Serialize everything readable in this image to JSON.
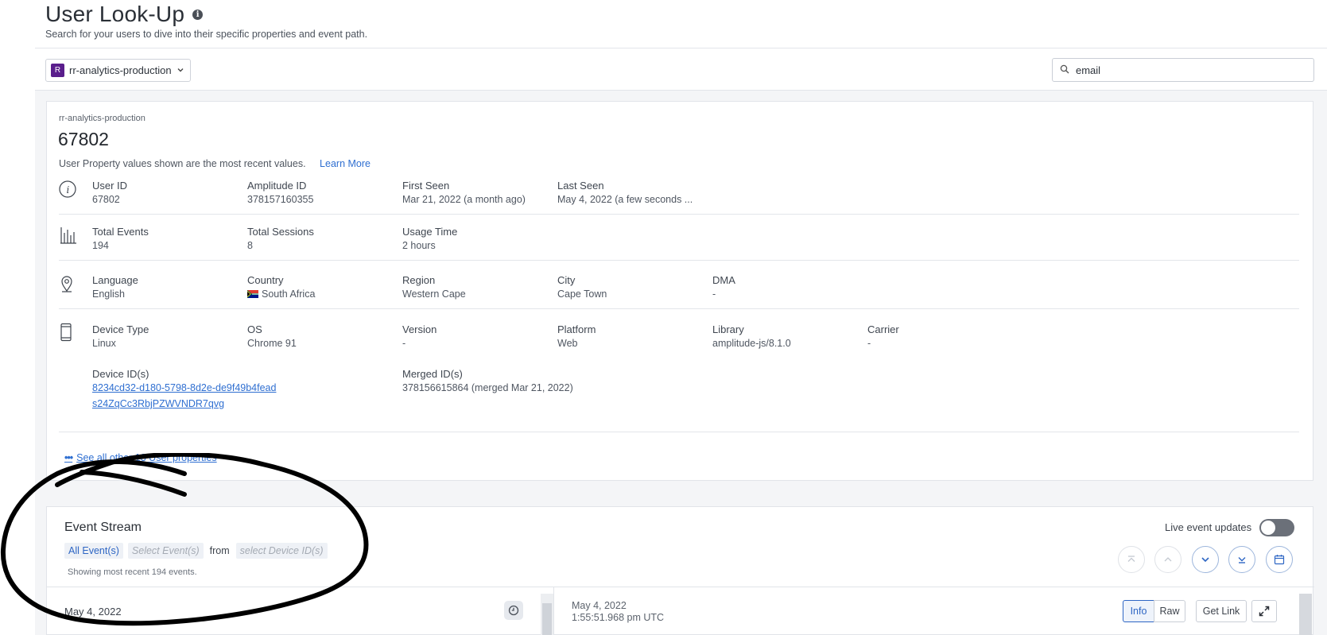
{
  "page": {
    "title": "User Look-Up",
    "subtitle": "Search for your users to dive into their specific properties and event path."
  },
  "toolbar": {
    "project_badge": "R",
    "project_name": "rr-analytics-production",
    "search_value": "email"
  },
  "profile": {
    "project_label": "rr-analytics-production",
    "user_display": "67802",
    "note": "User Property values shown are the most recent values.",
    "learn_more": "Learn More",
    "identity": {
      "user_id_label": "User ID",
      "user_id": "67802",
      "amplitude_id_label": "Amplitude ID",
      "amplitude_id": "378157160355",
      "first_seen_label": "First Seen",
      "first_seen": "Mar 21, 2022 (a month ago)",
      "last_seen_label": "Last Seen",
      "last_seen": "May 4, 2022 (a few seconds ..."
    },
    "usage": {
      "total_events_label": "Total Events",
      "total_events": "194",
      "total_sessions_label": "Total Sessions",
      "total_sessions": "8",
      "usage_time_label": "Usage Time",
      "usage_time": "2 hours"
    },
    "location": {
      "language_label": "Language",
      "language": "English",
      "country_label": "Country",
      "country": "South Africa",
      "region_label": "Region",
      "region": "Western Cape",
      "city_label": "City",
      "city": "Cape Town",
      "dma_label": "DMA",
      "dma": "-"
    },
    "device": {
      "device_type_label": "Device Type",
      "device_type": "Linux",
      "os_label": "OS",
      "os": "Chrome 91",
      "version_label": "Version",
      "version": "-",
      "platform_label": "Platform",
      "platform": "Web",
      "library_label": "Library",
      "library": "amplitude-js/8.1.0",
      "carrier_label": "Carrier",
      "carrier": "-",
      "device_ids_label": "Device ID(s)",
      "device_ids": [
        "8234cd32-d180-5798-8d2e-de9f49b4fead",
        "s24ZqCc3RbjPZWVNDR7qvg"
      ],
      "merged_ids_label": "Merged ID(s)",
      "merged_ids": "378156615864 (merged Mar 21, 2022)"
    },
    "see_all": "See all other 13 User properties"
  },
  "event_stream": {
    "title": "Event Stream",
    "filter_all": "All Event(s)",
    "filter_events_placeholder": "Select Event(s)",
    "filter_from": "from",
    "filter_devices_placeholder": "select Device ID(s)",
    "showing": "Showing most recent 194 events.",
    "live_updates_label": "Live event updates",
    "live_updates_on": false,
    "left_date": "May 4, 2022",
    "detail_date": "May 4, 2022",
    "detail_time": "1:55:51.968 pm UTC",
    "info_label": "Info",
    "raw_label": "Raw",
    "get_link_label": "Get Link"
  },
  "colors": {
    "accent": "#2f6fd1",
    "project_badge": "#5a1e8c",
    "annotation_ink": "#000000"
  }
}
